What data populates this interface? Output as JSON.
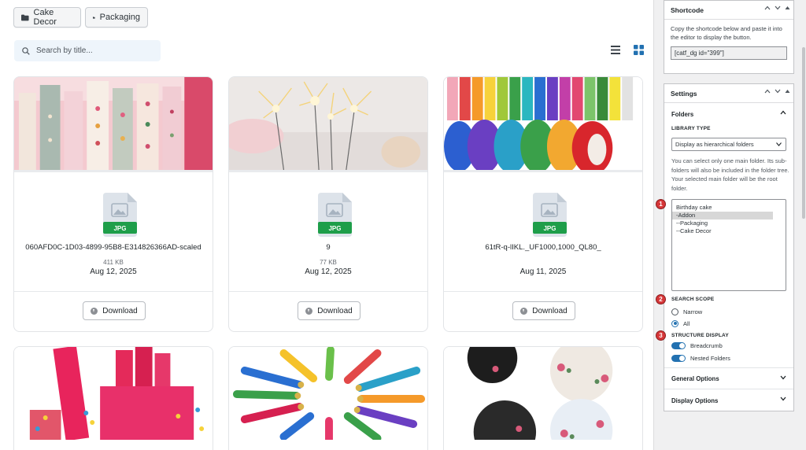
{
  "folders": {
    "cake_decor": "Cake Decor",
    "packaging": "Packaging"
  },
  "search": {
    "placeholder": "Search by title..."
  },
  "view": {
    "list_icon": "list-view-icon",
    "grid_icon": "grid-view-icon",
    "active": "grid"
  },
  "files": [
    {
      "name": "060AFD0C-1D03-4899-95B8-E314826366AD-scaled",
      "size": "411 KB",
      "date": "Aug 12, 2025",
      "type": "JPG",
      "download": "Download"
    },
    {
      "name": "9",
      "size": "77 KB",
      "date": "Aug 12, 2025",
      "type": "JPG",
      "download": "Download"
    },
    {
      "name": "61tR-q-lIKL._UF1000,1000_QL80_",
      "size": "",
      "date": "Aug 11, 2025",
      "type": "JPG",
      "download": "Download"
    }
  ],
  "shortcode": {
    "title": "Shortcode",
    "text": "Copy the shortcode below and paste it into the editor to display the button.",
    "value": "[catf_dg id=\"399\"]"
  },
  "settings": {
    "title": "Settings",
    "folders_title": "Folders",
    "library_type_label": "LIBRARY TYPE",
    "library_type_value": "Display as hierarchical folders",
    "desc": "You can select only one main folder. Its sub-folders will also be included in the folder tree. Your selected main folder will be the root folder.",
    "folder_options": [
      "Birthday cake",
      "-Addon",
      "--Packaging",
      "--Cake Decor"
    ],
    "selected_folder": "-Addon",
    "search_scope_label": "SEARCH SCOPE",
    "search_scope_options": [
      "Narrow",
      "All"
    ],
    "search_scope_selected": "All",
    "structure_label": "STRUCTURE DISPLAY",
    "structure_breadcrumb": "Breadcrumb",
    "structure_nested": "Nested Folders",
    "general_options": "General Options",
    "display_options": "Display Options"
  },
  "badges": [
    "1",
    "2",
    "3"
  ],
  "colors": {
    "accent": "#2271b1",
    "badge": "#d63638",
    "jpg_green": "#1e9e4a"
  }
}
